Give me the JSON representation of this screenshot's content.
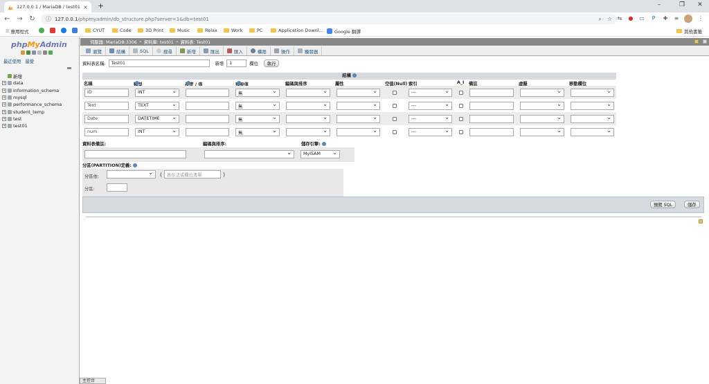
{
  "browser": {
    "tab_title": "127.0.0.1 / MariaDB / test01 / ",
    "url_host": "127.0.0.1",
    "url_path": "/phpmyadmin/db_structure.php?server=1&db=test01",
    "bookmarks": [
      "應用程式",
      "CYUT",
      "Code",
      "3D Print",
      "Music",
      "Relax",
      "Work",
      "PC",
      "Application Downl...",
      "Google 翻譯"
    ],
    "other_bookmarks": "其他書籤"
  },
  "sidebar": {
    "logo_php": "php",
    "logo_my": "My",
    "logo_admin": "Admin",
    "links": "最近使用　最愛",
    "tree": [
      {
        "label": "新增",
        "kind": "new"
      },
      {
        "label": "data",
        "kind": "db"
      },
      {
        "label": "information_schema",
        "kind": "db"
      },
      {
        "label": "mysql",
        "kind": "db"
      },
      {
        "label": "performance_schema",
        "kind": "db"
      },
      {
        "label": "student_temp",
        "kind": "db"
      },
      {
        "label": "test",
        "kind": "db"
      },
      {
        "label": "test01",
        "kind": "db"
      }
    ],
    "bottom_console": "主控台"
  },
  "crumbs": {
    "server": "伺服器: MariaDB:3306",
    "database": "資料庫: test01",
    "table": "資料表: Test01"
  },
  "tabs": [
    "瀏覽",
    "結構",
    "SQL",
    "搜尋",
    "新增",
    "匯出",
    "匯入",
    "權限",
    "操作",
    "觸發器"
  ],
  "create": {
    "name_label": "資料表名稱:",
    "name_value": "Test01",
    "add_label": "新增",
    "add_count": "1",
    "col_label": "欄位",
    "go_button": "執行"
  },
  "structure": {
    "heading": "結構",
    "columns": [
      "名稱",
      "類型",
      "長度 / 值",
      "預設值",
      "編碼與排序",
      "屬性",
      "空值(Null)",
      "索引",
      "A_I",
      "備註",
      "虛擬",
      "移動欄位"
    ],
    "rows": [
      {
        "name": "ID",
        "type": "INT",
        "length": "",
        "default": "無",
        "index": "---"
      },
      {
        "name": "Text",
        "type": "TEXT",
        "length": "",
        "default": "無",
        "index": "---"
      },
      {
        "name": "Date",
        "type": "DATETIME",
        "length": "",
        "default": "無",
        "index": "---"
      },
      {
        "name": "num",
        "type": "INT",
        "length": "",
        "default": "無",
        "index": "---"
      }
    ]
  },
  "options": {
    "comment_label": "資料表備註:",
    "collation_label": "編碼與排序:",
    "engine_label": "儲存引擎:",
    "engine_value": "MyISAM"
  },
  "partition": {
    "title": "分區(PARTITION)定義:",
    "by_label": "分區依:",
    "expr_placeholder": "表示法或欄位清單",
    "count_label": "分區:"
  },
  "actions": {
    "preview_sql": "預覽 SQL",
    "save": "儲存"
  }
}
